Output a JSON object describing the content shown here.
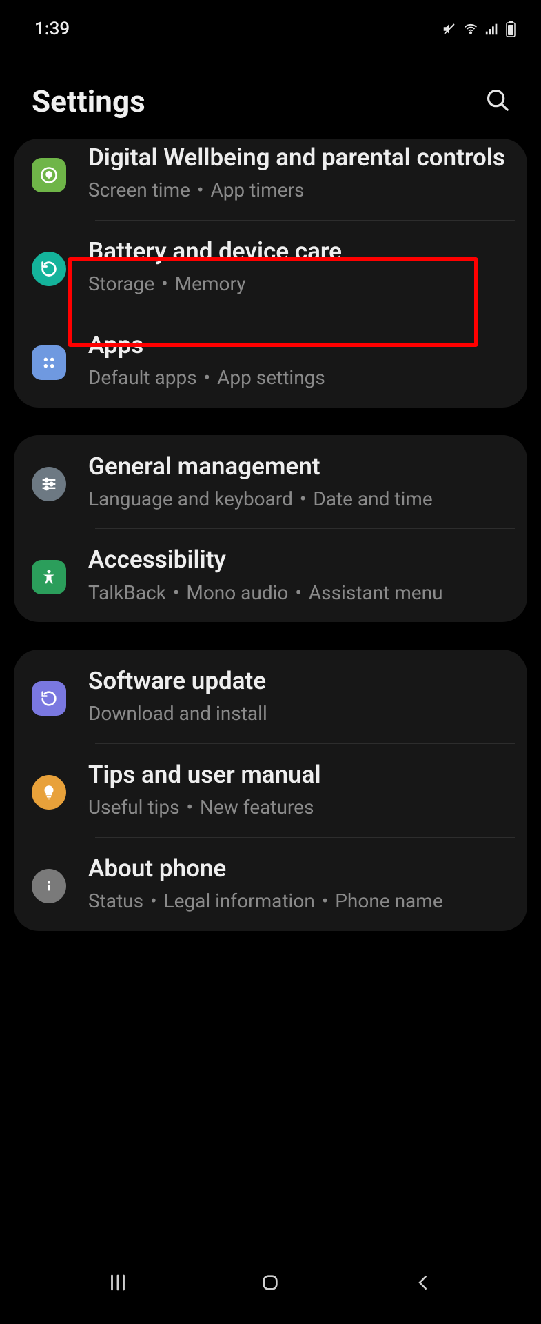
{
  "status": {
    "time": "1:39"
  },
  "header": {
    "title": "Settings"
  },
  "highlight": {
    "target": "battery-and-device-care"
  },
  "groups": [
    {
      "items": [
        {
          "id": "digital-wellbeing",
          "title": "Digital Wellbeing and parental controls",
          "sub": [
            "Screen time",
            "App timers"
          ]
        },
        {
          "id": "battery-and-device-care",
          "title": "Battery and device care",
          "sub": [
            "Storage",
            "Memory"
          ]
        },
        {
          "id": "apps",
          "title": "Apps",
          "sub": [
            "Default apps",
            "App settings"
          ]
        }
      ]
    },
    {
      "items": [
        {
          "id": "general-management",
          "title": "General management",
          "sub": [
            "Language and keyboard",
            "Date and time"
          ]
        },
        {
          "id": "accessibility",
          "title": "Accessibility",
          "sub": [
            "TalkBack",
            "Mono audio",
            "Assistant menu"
          ]
        }
      ]
    },
    {
      "items": [
        {
          "id": "software-update",
          "title": "Software update",
          "sub": [
            "Download and install"
          ]
        },
        {
          "id": "tips",
          "title": "Tips and user manual",
          "sub": [
            "Useful tips",
            "New features"
          ]
        },
        {
          "id": "about-phone",
          "title": "About phone",
          "sub": [
            "Status",
            "Legal information",
            "Phone name"
          ]
        }
      ]
    }
  ]
}
